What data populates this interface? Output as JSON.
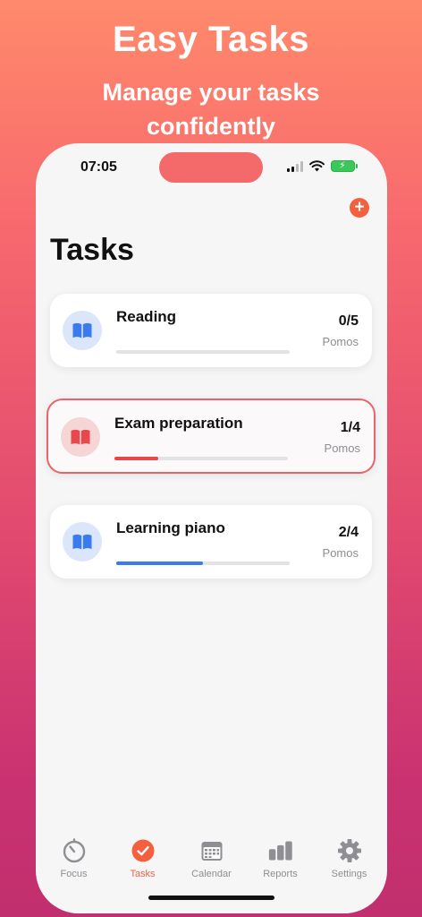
{
  "promo": {
    "headline": "Easy Tasks",
    "subline": "Manage your tasks confidently"
  },
  "status_bar": {
    "time": "07:05",
    "icons": [
      "signal-icon",
      "wifi-icon",
      "battery-charging-icon"
    ]
  },
  "header": {
    "title": "Tasks",
    "add_icon": "plus-icon"
  },
  "tasks": [
    {
      "name": "Reading",
      "count": "0/5",
      "unit": "Pomos",
      "progress": 0.0,
      "accent": "#3b7bf0",
      "icon_bg": "#dbe6fb",
      "selected": false
    },
    {
      "name": "Exam preparation",
      "count": "1/4",
      "unit": "Pomos",
      "progress": 0.25,
      "accent": "#e8474b",
      "icon_bg": "#f6d5d6",
      "selected": true
    },
    {
      "name": "Learning piano",
      "count": "2/4",
      "unit": "Pomos",
      "progress": 0.5,
      "accent": "#3b7bf0",
      "icon_bg": "#dbe6fb",
      "selected": false
    }
  ],
  "tabbar": {
    "items": [
      {
        "label": "Focus",
        "icon": "timer-icon",
        "active": false
      },
      {
        "label": "Tasks",
        "icon": "checkmark-circle-icon",
        "active": true
      },
      {
        "label": "Calendar",
        "icon": "calendar-icon",
        "active": false
      },
      {
        "label": "Reports",
        "icon": "bar-chart-icon",
        "active": false
      },
      {
        "label": "Settings",
        "icon": "gear-icon",
        "active": false
      }
    ]
  },
  "colors": {
    "accent": "#f4603e",
    "inactive": "#8e8e93"
  }
}
